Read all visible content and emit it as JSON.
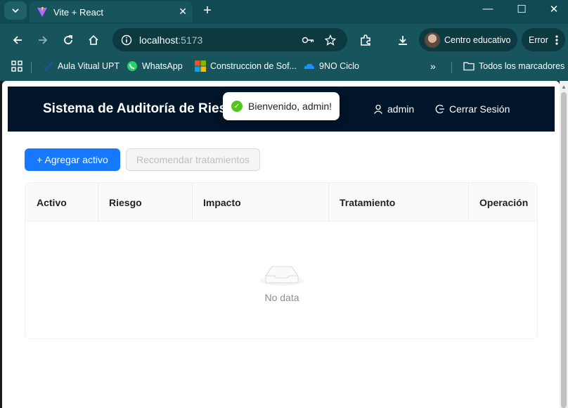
{
  "browser": {
    "tab_title": "Vite + React",
    "url_host": "localhost",
    "url_port": ":5173",
    "profile_name": "Centro educativo",
    "error_label": "Error"
  },
  "bookmarks": [
    {
      "label": "Aula Vitual UPT",
      "icon": "upt-icon"
    },
    {
      "label": "WhatsApp",
      "icon": "whatsapp-icon"
    },
    {
      "label": "Construccion de Sof...",
      "icon": "microsoft-icon"
    },
    {
      "label": "9NO Ciclo",
      "icon": "onedrive-icon"
    }
  ],
  "bookmarks_all": "Todos los marcadores",
  "app": {
    "title": "Sistema de Auditoría de Ries",
    "user": "admin",
    "logout": "Cerrar Sesión"
  },
  "toast": {
    "message": "Bienvenido, admin!"
  },
  "actions": {
    "add_asset": "+ Agregar activo",
    "recommend": "Recomendar tratamientos"
  },
  "table": {
    "columns": [
      "Activo",
      "Riesgo",
      "Impacto",
      "Tratamiento",
      "Operación"
    ],
    "empty_text": "No data"
  },
  "colors": {
    "primary": "#1677ff",
    "header_bg": "#001529",
    "success": "#52c41a",
    "chrome": "#17545c"
  }
}
